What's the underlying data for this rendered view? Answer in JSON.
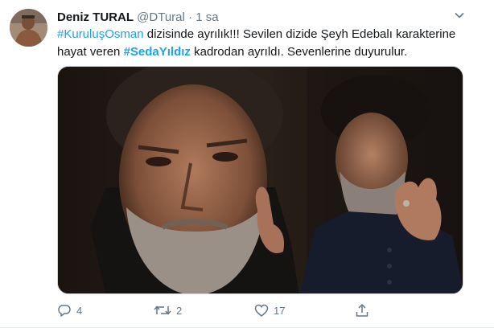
{
  "tweet": {
    "author_name": "Deniz TURAL",
    "handle": "@DTural",
    "separator": "·",
    "time": "1 sa",
    "text": {
      "hashtag1": "#KuruluşOsman",
      "part1": " dizisinde ayrılık!!! Sevilen dizide Şeyh Edebalı karakterine hayat veren ",
      "hashtag2": "#SedaYıldız",
      "part2": " kadrodan ayrıldı. Sevenlerine duyurulur."
    }
  },
  "actions": {
    "reply": {
      "icon": "reply-icon",
      "count": "4"
    },
    "retweet": {
      "icon": "retweet-icon",
      "count": "2"
    },
    "like": {
      "icon": "heart-icon",
      "count": "17"
    },
    "share": {
      "icon": "share-icon"
    }
  },
  "colors": {
    "link": "#1da1f2",
    "meta": "#657786",
    "text": "#14171a"
  }
}
